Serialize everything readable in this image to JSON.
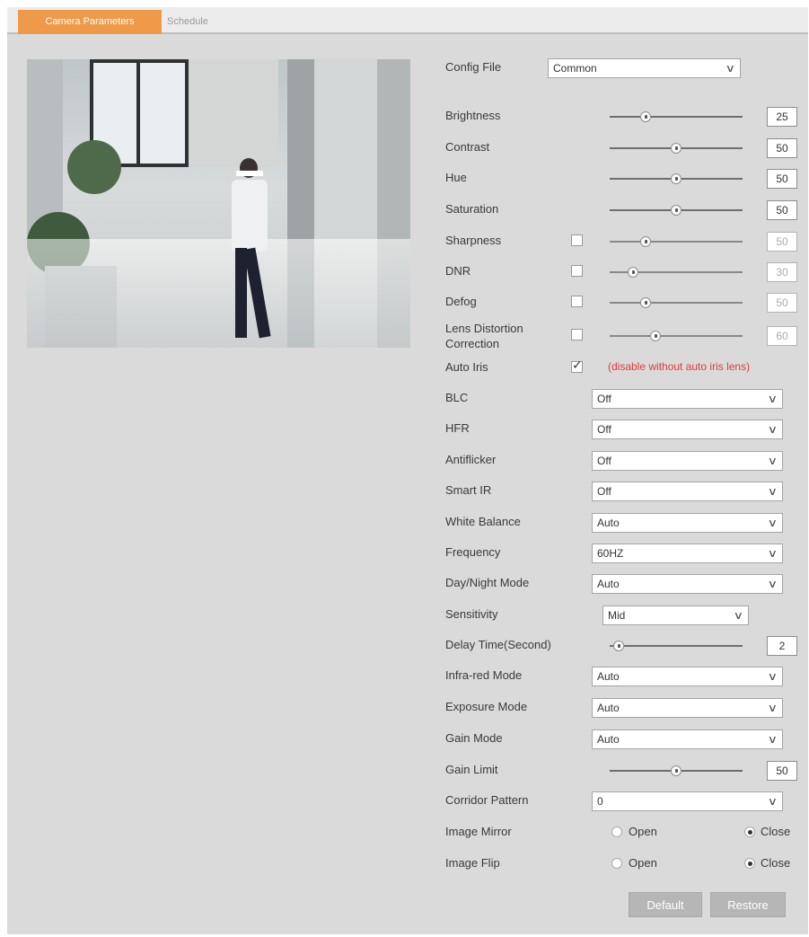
{
  "tabs": [
    {
      "label": "Camera Parameters",
      "active": true
    },
    {
      "label": "Schedule",
      "active": false
    }
  ],
  "config_file": {
    "label": "Config File",
    "value": "Common"
  },
  "sliders": {
    "brightness": {
      "label": "Brightness",
      "value": "25",
      "position": 0.25
    },
    "contrast": {
      "label": "Contrast",
      "value": "50",
      "position": 0.5
    },
    "hue": {
      "label": "Hue",
      "value": "50",
      "position": 0.5
    },
    "saturation": {
      "label": "Saturation",
      "value": "50",
      "position": 0.5
    },
    "sharpness": {
      "label": "Sharpness",
      "value": "50",
      "position": 0.25,
      "enabled": false
    },
    "dnr": {
      "label": "DNR",
      "value": "30",
      "position": 0.15,
      "enabled": false
    },
    "defog": {
      "label": "Defog",
      "value": "50",
      "position": 0.25,
      "enabled": false
    },
    "lens_distortion": {
      "label_line1": "Lens Distortion",
      "label_line2": "Correction",
      "value": "60",
      "position": 0.33,
      "enabled": false
    },
    "delay_time": {
      "label": "Delay Time(Second)",
      "value": "2",
      "position": 0.03
    },
    "gain_limit": {
      "label": "Gain Limit",
      "value": "50",
      "position": 0.5
    }
  },
  "auto_iris": {
    "label": "Auto Iris",
    "checked": true,
    "note": "(disable without auto iris lens)"
  },
  "selects": {
    "blc": {
      "label": "BLC",
      "value": "Off"
    },
    "hfr": {
      "label": "HFR",
      "value": "Off"
    },
    "antiflicker": {
      "label": "Antiflicker",
      "value": "Off"
    },
    "smart_ir": {
      "label": "Smart IR",
      "value": "Off"
    },
    "white_balance": {
      "label": "White Balance",
      "value": "Auto"
    },
    "frequency": {
      "label": "Frequency",
      "value": "60HZ"
    },
    "day_night": {
      "label": "Day/Night Mode",
      "value": "Auto"
    },
    "sensitivity": {
      "label": "Sensitivity",
      "value": "Mid"
    },
    "infrared": {
      "label": "Infra-red Mode",
      "value": "Auto"
    },
    "exposure": {
      "label": "Exposure Mode",
      "value": "Auto"
    },
    "gain_mode": {
      "label": "Gain Mode",
      "value": "Auto"
    },
    "corridor": {
      "label": "Corridor Pattern",
      "value": "0"
    }
  },
  "image_mirror": {
    "label": "Image Mirror",
    "open_label": "Open",
    "close_label": "Close",
    "selected": "close"
  },
  "image_flip": {
    "label": "Image Flip",
    "open_label": "Open",
    "close_label": "Close",
    "selected": "close"
  },
  "buttons": {
    "default": "Default",
    "restore": "Restore"
  },
  "colors": {
    "tab_active": "#ee9a48",
    "note": "#e23a3a",
    "panel_bg": "#dadada"
  }
}
